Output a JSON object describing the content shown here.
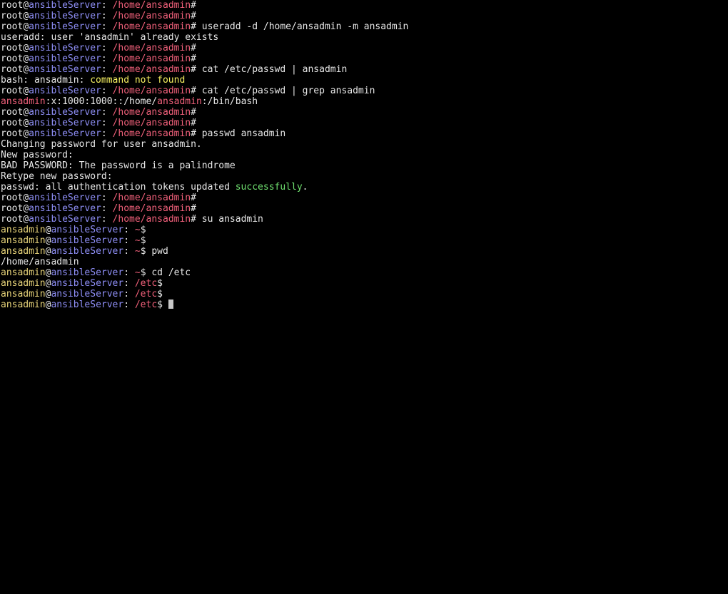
{
  "colors": {
    "background": "#000000",
    "default": "#e8e8e8",
    "user": "#e8d47a",
    "host": "#8f8ff7",
    "path": "#f0607a",
    "highlight": "#f5f060",
    "success": "#6fe06f",
    "cursor": "#c8c8c8"
  },
  "terminal": {
    "cursor_shown": true,
    "lines": [
      [
        {
          "text": "root",
          "c": "default"
        },
        {
          "text": "@",
          "c": "default"
        },
        {
          "text": "ansibleServer",
          "c": "host"
        },
        {
          "text": ": ",
          "c": "default"
        },
        {
          "text": "/home/ansadmin",
          "c": "path"
        },
        {
          "text": "#",
          "c": "default"
        }
      ],
      [
        {
          "text": "root",
          "c": "default"
        },
        {
          "text": "@",
          "c": "default"
        },
        {
          "text": "ansibleServer",
          "c": "host"
        },
        {
          "text": ": ",
          "c": "default"
        },
        {
          "text": "/home/ansadmin",
          "c": "path"
        },
        {
          "text": "#",
          "c": "default"
        }
      ],
      [
        {
          "text": "root",
          "c": "default"
        },
        {
          "text": "@",
          "c": "default"
        },
        {
          "text": "ansibleServer",
          "c": "host"
        },
        {
          "text": ": ",
          "c": "default"
        },
        {
          "text": "/home/ansadmin",
          "c": "path"
        },
        {
          "text": "# useradd -d /home/ansadmin -m ansadmin",
          "c": "default"
        }
      ],
      [
        {
          "text": "useradd: user 'ansadmin' already exists",
          "c": "default"
        }
      ],
      [
        {
          "text": "root",
          "c": "default"
        },
        {
          "text": "@",
          "c": "default"
        },
        {
          "text": "ansibleServer",
          "c": "host"
        },
        {
          "text": ": ",
          "c": "default"
        },
        {
          "text": "/home/ansadmin",
          "c": "path"
        },
        {
          "text": "#",
          "c": "default"
        }
      ],
      [
        {
          "text": "root",
          "c": "default"
        },
        {
          "text": "@",
          "c": "default"
        },
        {
          "text": "ansibleServer",
          "c": "host"
        },
        {
          "text": ": ",
          "c": "default"
        },
        {
          "text": "/home/ansadmin",
          "c": "path"
        },
        {
          "text": "#",
          "c": "default"
        }
      ],
      [
        {
          "text": "root",
          "c": "default"
        },
        {
          "text": "@",
          "c": "default"
        },
        {
          "text": "ansibleServer",
          "c": "host"
        },
        {
          "text": ": ",
          "c": "default"
        },
        {
          "text": "/home/ansadmin",
          "c": "path"
        },
        {
          "text": "# cat /etc/passwd | ansadmin",
          "c": "default"
        }
      ],
      [
        {
          "text": "bash: ansadmin: ",
          "c": "default"
        },
        {
          "text": "command not found",
          "c": "highlight"
        }
      ],
      [
        {
          "text": "root",
          "c": "default"
        },
        {
          "text": "@",
          "c": "default"
        },
        {
          "text": "ansibleServer",
          "c": "host"
        },
        {
          "text": ": ",
          "c": "default"
        },
        {
          "text": "/home/ansadmin",
          "c": "path"
        },
        {
          "text": "# cat /etc/passwd | grep ansadmin",
          "c": "default"
        }
      ],
      [
        {
          "text": "ansadmin",
          "c": "path"
        },
        {
          "text": ":x:1000:1000::/home/",
          "c": "default"
        },
        {
          "text": "ansadmin",
          "c": "path"
        },
        {
          "text": ":/bin/bash",
          "c": "default"
        }
      ],
      [
        {
          "text": "root",
          "c": "default"
        },
        {
          "text": "@",
          "c": "default"
        },
        {
          "text": "ansibleServer",
          "c": "host"
        },
        {
          "text": ": ",
          "c": "default"
        },
        {
          "text": "/home/ansadmin",
          "c": "path"
        },
        {
          "text": "#",
          "c": "default"
        }
      ],
      [
        {
          "text": "root",
          "c": "default"
        },
        {
          "text": "@",
          "c": "default"
        },
        {
          "text": "ansibleServer",
          "c": "host"
        },
        {
          "text": ": ",
          "c": "default"
        },
        {
          "text": "/home/ansadmin",
          "c": "path"
        },
        {
          "text": "#",
          "c": "default"
        }
      ],
      [
        {
          "text": "root",
          "c": "default"
        },
        {
          "text": "@",
          "c": "default"
        },
        {
          "text": "ansibleServer",
          "c": "host"
        },
        {
          "text": ": ",
          "c": "default"
        },
        {
          "text": "/home/ansadmin",
          "c": "path"
        },
        {
          "text": "# passwd ansadmin",
          "c": "default"
        }
      ],
      [
        {
          "text": "Changing password for user ansadmin.",
          "c": "default"
        }
      ],
      [
        {
          "text": "New password:",
          "c": "default"
        }
      ],
      [
        {
          "text": "BAD PASSWORD: The password is a palindrome",
          "c": "default"
        }
      ],
      [
        {
          "text": "Retype new password:",
          "c": "default"
        }
      ],
      [
        {
          "text": "passwd: all authentication tokens updated ",
          "c": "default"
        },
        {
          "text": "successfully",
          "c": "success"
        },
        {
          "text": ".",
          "c": "default"
        }
      ],
      [
        {
          "text": "root",
          "c": "default"
        },
        {
          "text": "@",
          "c": "default"
        },
        {
          "text": "ansibleServer",
          "c": "host"
        },
        {
          "text": ": ",
          "c": "default"
        },
        {
          "text": "/home/ansadmin",
          "c": "path"
        },
        {
          "text": "#",
          "c": "default"
        }
      ],
      [
        {
          "text": "root",
          "c": "default"
        },
        {
          "text": "@",
          "c": "default"
        },
        {
          "text": "ansibleServer",
          "c": "host"
        },
        {
          "text": ": ",
          "c": "default"
        },
        {
          "text": "/home/ansadmin",
          "c": "path"
        },
        {
          "text": "#",
          "c": "default"
        }
      ],
      [
        {
          "text": "root",
          "c": "default"
        },
        {
          "text": "@",
          "c": "default"
        },
        {
          "text": "ansibleServer",
          "c": "host"
        },
        {
          "text": ": ",
          "c": "default"
        },
        {
          "text": "/home/ansadmin",
          "c": "path"
        },
        {
          "text": "# su ansadmin",
          "c": "default"
        }
      ],
      [
        {
          "text": "ansadmin",
          "c": "user"
        },
        {
          "text": "@",
          "c": "default"
        },
        {
          "text": "ansibleServer",
          "c": "host"
        },
        {
          "text": ": ",
          "c": "default"
        },
        {
          "text": "~",
          "c": "path"
        },
        {
          "text": "$",
          "c": "default"
        }
      ],
      [
        {
          "text": "ansadmin",
          "c": "user"
        },
        {
          "text": "@",
          "c": "default"
        },
        {
          "text": "ansibleServer",
          "c": "host"
        },
        {
          "text": ": ",
          "c": "default"
        },
        {
          "text": "~",
          "c": "path"
        },
        {
          "text": "$",
          "c": "default"
        }
      ],
      [
        {
          "text": "ansadmin",
          "c": "user"
        },
        {
          "text": "@",
          "c": "default"
        },
        {
          "text": "ansibleServer",
          "c": "host"
        },
        {
          "text": ": ",
          "c": "default"
        },
        {
          "text": "~",
          "c": "path"
        },
        {
          "text": "$ pwd",
          "c": "default"
        }
      ],
      [
        {
          "text": "/home/ansadmin",
          "c": "default"
        }
      ],
      [
        {
          "text": "ansadmin",
          "c": "user"
        },
        {
          "text": "@",
          "c": "default"
        },
        {
          "text": "ansibleServer",
          "c": "host"
        },
        {
          "text": ": ",
          "c": "default"
        },
        {
          "text": "~",
          "c": "path"
        },
        {
          "text": "$ cd /etc",
          "c": "default"
        }
      ],
      [
        {
          "text": "ansadmin",
          "c": "user"
        },
        {
          "text": "@",
          "c": "default"
        },
        {
          "text": "ansibleServer",
          "c": "host"
        },
        {
          "text": ": ",
          "c": "default"
        },
        {
          "text": "/etc",
          "c": "path"
        },
        {
          "text": "$",
          "c": "default"
        }
      ],
      [
        {
          "text": "ansadmin",
          "c": "user"
        },
        {
          "text": "@",
          "c": "default"
        },
        {
          "text": "ansibleServer",
          "c": "host"
        },
        {
          "text": ": ",
          "c": "default"
        },
        {
          "text": "/etc",
          "c": "path"
        },
        {
          "text": "$",
          "c": "default"
        }
      ],
      [
        {
          "text": "ansadmin",
          "c": "user"
        },
        {
          "text": "@",
          "c": "default"
        },
        {
          "text": "ansibleServer",
          "c": "host"
        },
        {
          "text": ": ",
          "c": "default"
        },
        {
          "text": "/etc",
          "c": "path"
        },
        {
          "text": "$ ",
          "c": "default"
        }
      ]
    ]
  }
}
